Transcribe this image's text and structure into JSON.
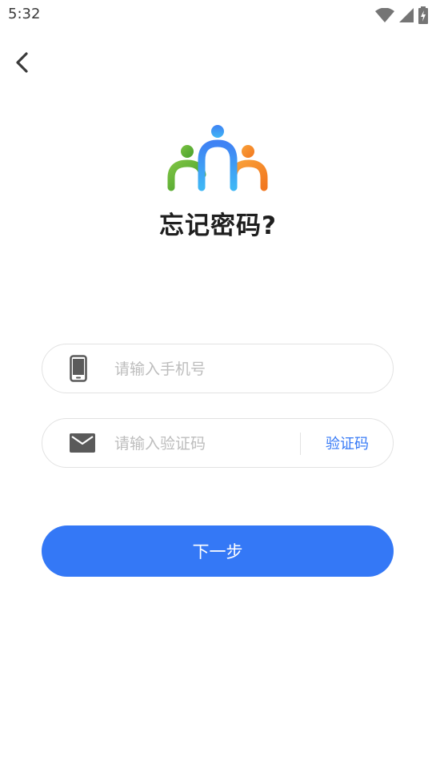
{
  "status_bar": {
    "time": "5:32",
    "icons": [
      "wifi-icon",
      "signal-icon",
      "battery-charging-icon"
    ]
  },
  "header": {
    "back_icon": "chevron-left-icon"
  },
  "logo": {
    "name": "three-people-logo",
    "colors": [
      "#5aa92e",
      "#3a8cf4",
      "#f6912d"
    ]
  },
  "title": "忘记密码?",
  "form": {
    "phone": {
      "icon": "mobile-phone-icon",
      "placeholder": "请输入手机号",
      "value": ""
    },
    "code": {
      "icon": "mail-envelope-icon",
      "placeholder": "请输入验证码",
      "value": "",
      "button_label": "验证码"
    }
  },
  "next_button": {
    "label": "下一步"
  },
  "colors": {
    "accent": "#3478f6",
    "field_border": "#e2e2e2",
    "placeholder": "#bdbdbd",
    "title": "#1f1f1f"
  }
}
